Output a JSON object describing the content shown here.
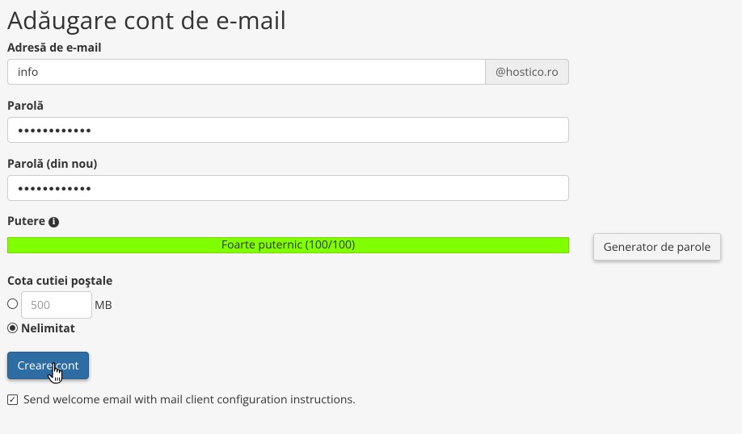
{
  "page": {
    "title": "Adăugare cont de e-mail"
  },
  "email": {
    "label": "Adresă de e-mail",
    "value": "info",
    "domain": "@hostico.ro"
  },
  "password": {
    "label": "Parolă",
    "masked": "●●●●●●●●●●●●"
  },
  "password_repeat": {
    "label": "Parolă (din nou)",
    "masked": "●●●●●●●●●●●●"
  },
  "strength": {
    "label": "Putere",
    "meter_text": "Foarte puternic (100/100)",
    "score": 100,
    "max": 100,
    "color": "#7fff00"
  },
  "generator_button": "Generator de parole",
  "quota": {
    "label": "Cota cutiei poştale",
    "placeholder": "500",
    "unit": "MB",
    "unlimited_label": "Nelimitat",
    "selected": "unlimited"
  },
  "create_button": "Creare cont",
  "welcome_email": {
    "label": "Send welcome email with mail client configuration instructions.",
    "checked": true
  },
  "colors": {
    "primary_button": "#2e6da4",
    "meter": "#7fff00",
    "background": "#f6f6f6"
  }
}
